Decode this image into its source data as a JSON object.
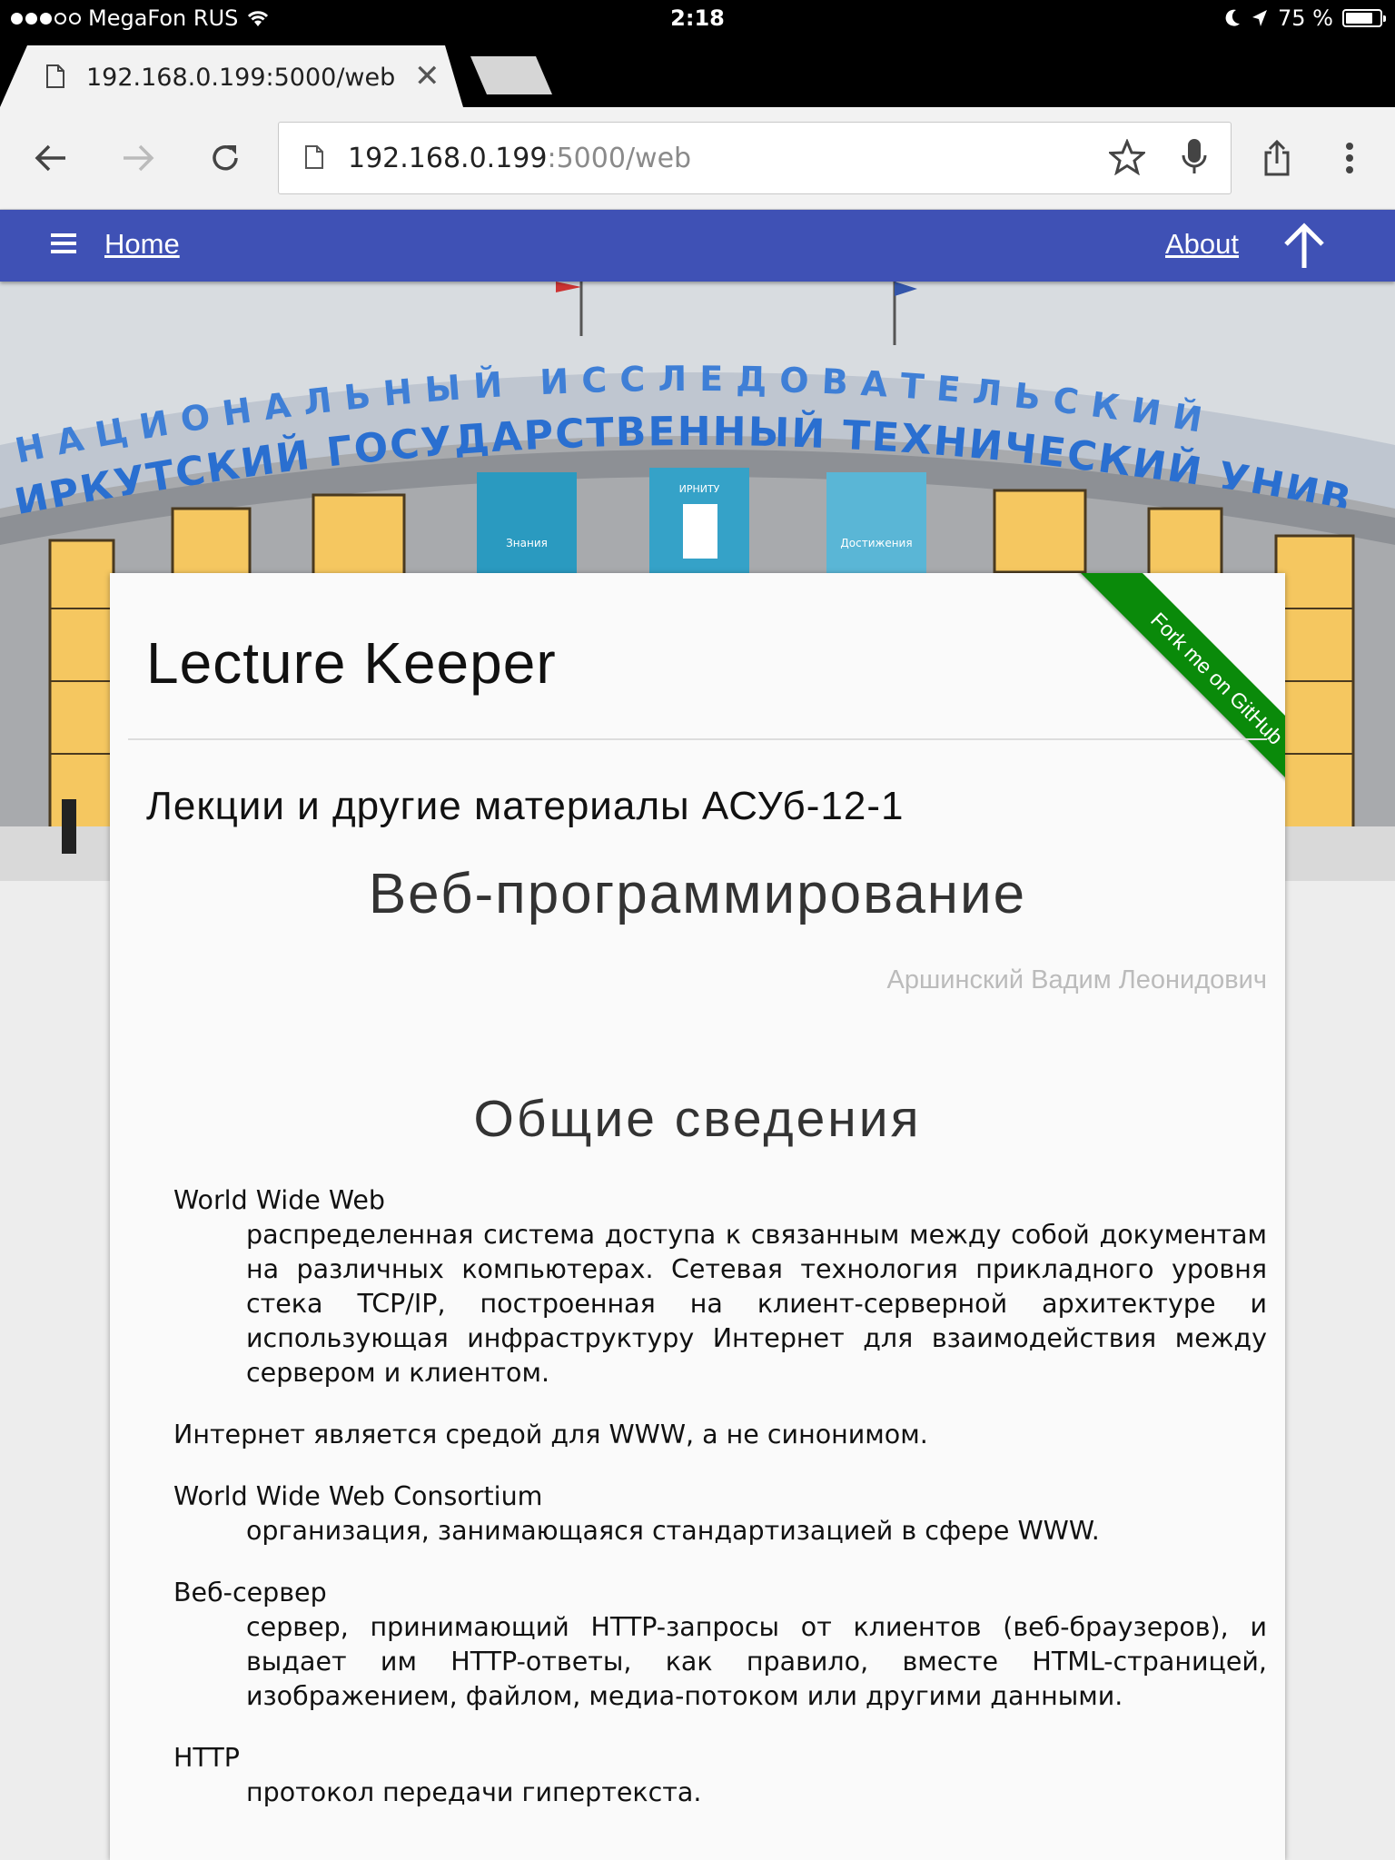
{
  "status_bar": {
    "carrier": "MegaFon RUS",
    "time": "2:18",
    "battery": "75 %"
  },
  "browser": {
    "tab_title": "192.168.0.199:5000/web",
    "url_host": "192.168.0.199",
    "url_rest": ":5000/web"
  },
  "nav": {
    "home": "Home",
    "about": "About"
  },
  "page": {
    "site_title": "Lecture Keeper",
    "ribbon": "Fork me on GitHub",
    "subtitle": "Лекции и другие материалы АСУб-12-1",
    "course_title": "Веб-программирование",
    "author": "Аршинский Вадим Леонидович",
    "section_title": "Общие сведения",
    "definitions": [
      {
        "term": "World Wide Web",
        "desc": "распределенная система доступа к связанным между собой документам на различных компьютерах. Сетевая технология прикладного уровня стека TCP/IP, построенная на клиент-серверной архитектуре и использующая инфраструктуру Интернет для взаимодействия между сервером и клиентом."
      },
      {
        "plain": "Интернет является средой для WWW, а не синонимом."
      },
      {
        "term": "World Wide Web Consortium",
        "desc": "организация, занимающаяся стандартизацией в сфере WWW."
      },
      {
        "term": "Веб-сервер",
        "desc": "сервер, принимающий HTTP-запросы от клиентов (веб-браузеров), и выдает им HTTP-ответы, как правило, вместе HTML-страницей, изображением, файлом, медиа-потоком или другими данными."
      },
      {
        "term": "HTTP",
        "desc": "протокол передачи гипертекста."
      }
    ]
  },
  "hero": {
    "sign_line1": "НАЦИОНАЛЬНЫЙ ИССЛЕДОВАТЕЛЬСКИЙ",
    "sign_line2": "ИРКУТСКИЙ ГОСУДАРСТВЕННЫЙ ТЕХНИЧЕСКИЙ УНИВЕРСИТЕТ",
    "banner_left": "Знания",
    "banner_mid": "ИРНИТУ",
    "banner_right": "Достижения"
  }
}
